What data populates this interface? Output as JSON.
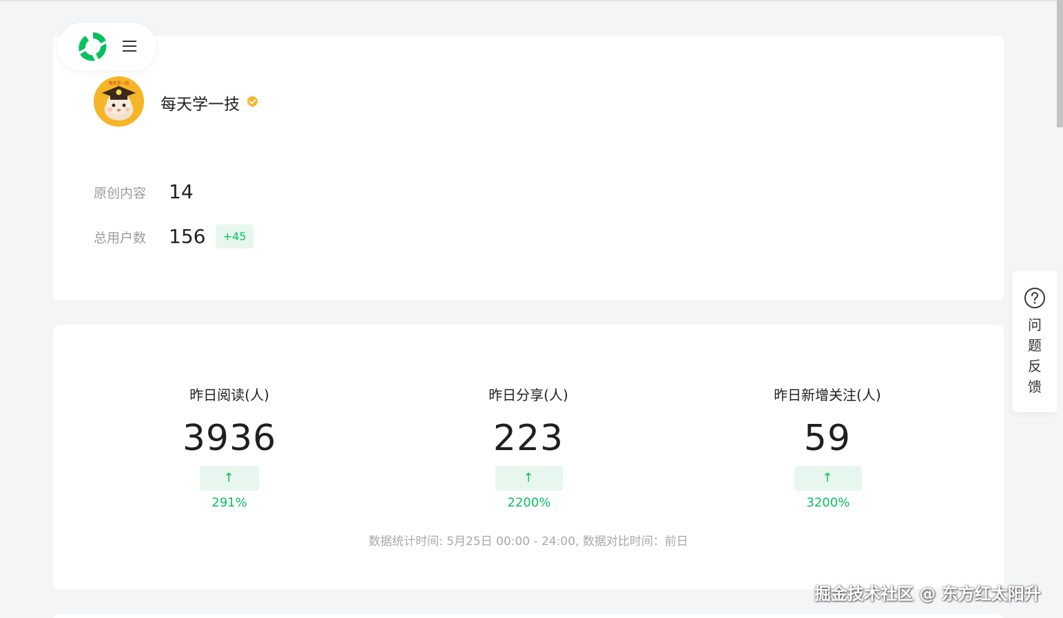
{
  "account": {
    "name": "每天学一技",
    "avatar_text": "每天学一技"
  },
  "profile_stats": {
    "original_label": "原创内容",
    "original_value": "14",
    "users_label": "总用户数",
    "users_value": "156",
    "users_delta": "+45"
  },
  "metrics": [
    {
      "label": "昨日阅读(人)",
      "value": "3936",
      "change": "291%"
    },
    {
      "label": "昨日分享(人)",
      "value": "223",
      "change": "2200%"
    },
    {
      "label": "昨日新增关注(人)",
      "value": "59",
      "change": "3200%"
    }
  ],
  "arrow": "↑",
  "footnote": "数据统计时间: 5月25日 00:00 - 24:00, 数据对比时间：前日",
  "feedback": {
    "chars": [
      "问",
      "题",
      "反",
      "馈"
    ]
  },
  "watermark": "掘金技术社区 @ 东方红太阳升",
  "colors": {
    "accent": "#07c160",
    "badge_bg": "#e7f7ed",
    "verified": "#f5b526"
  },
  "icons": {
    "logo": "brand-logo-icon",
    "menu": "hamburger-menu-icon",
    "verified": "verified-badge-icon",
    "feedback": "question-circle-icon"
  }
}
